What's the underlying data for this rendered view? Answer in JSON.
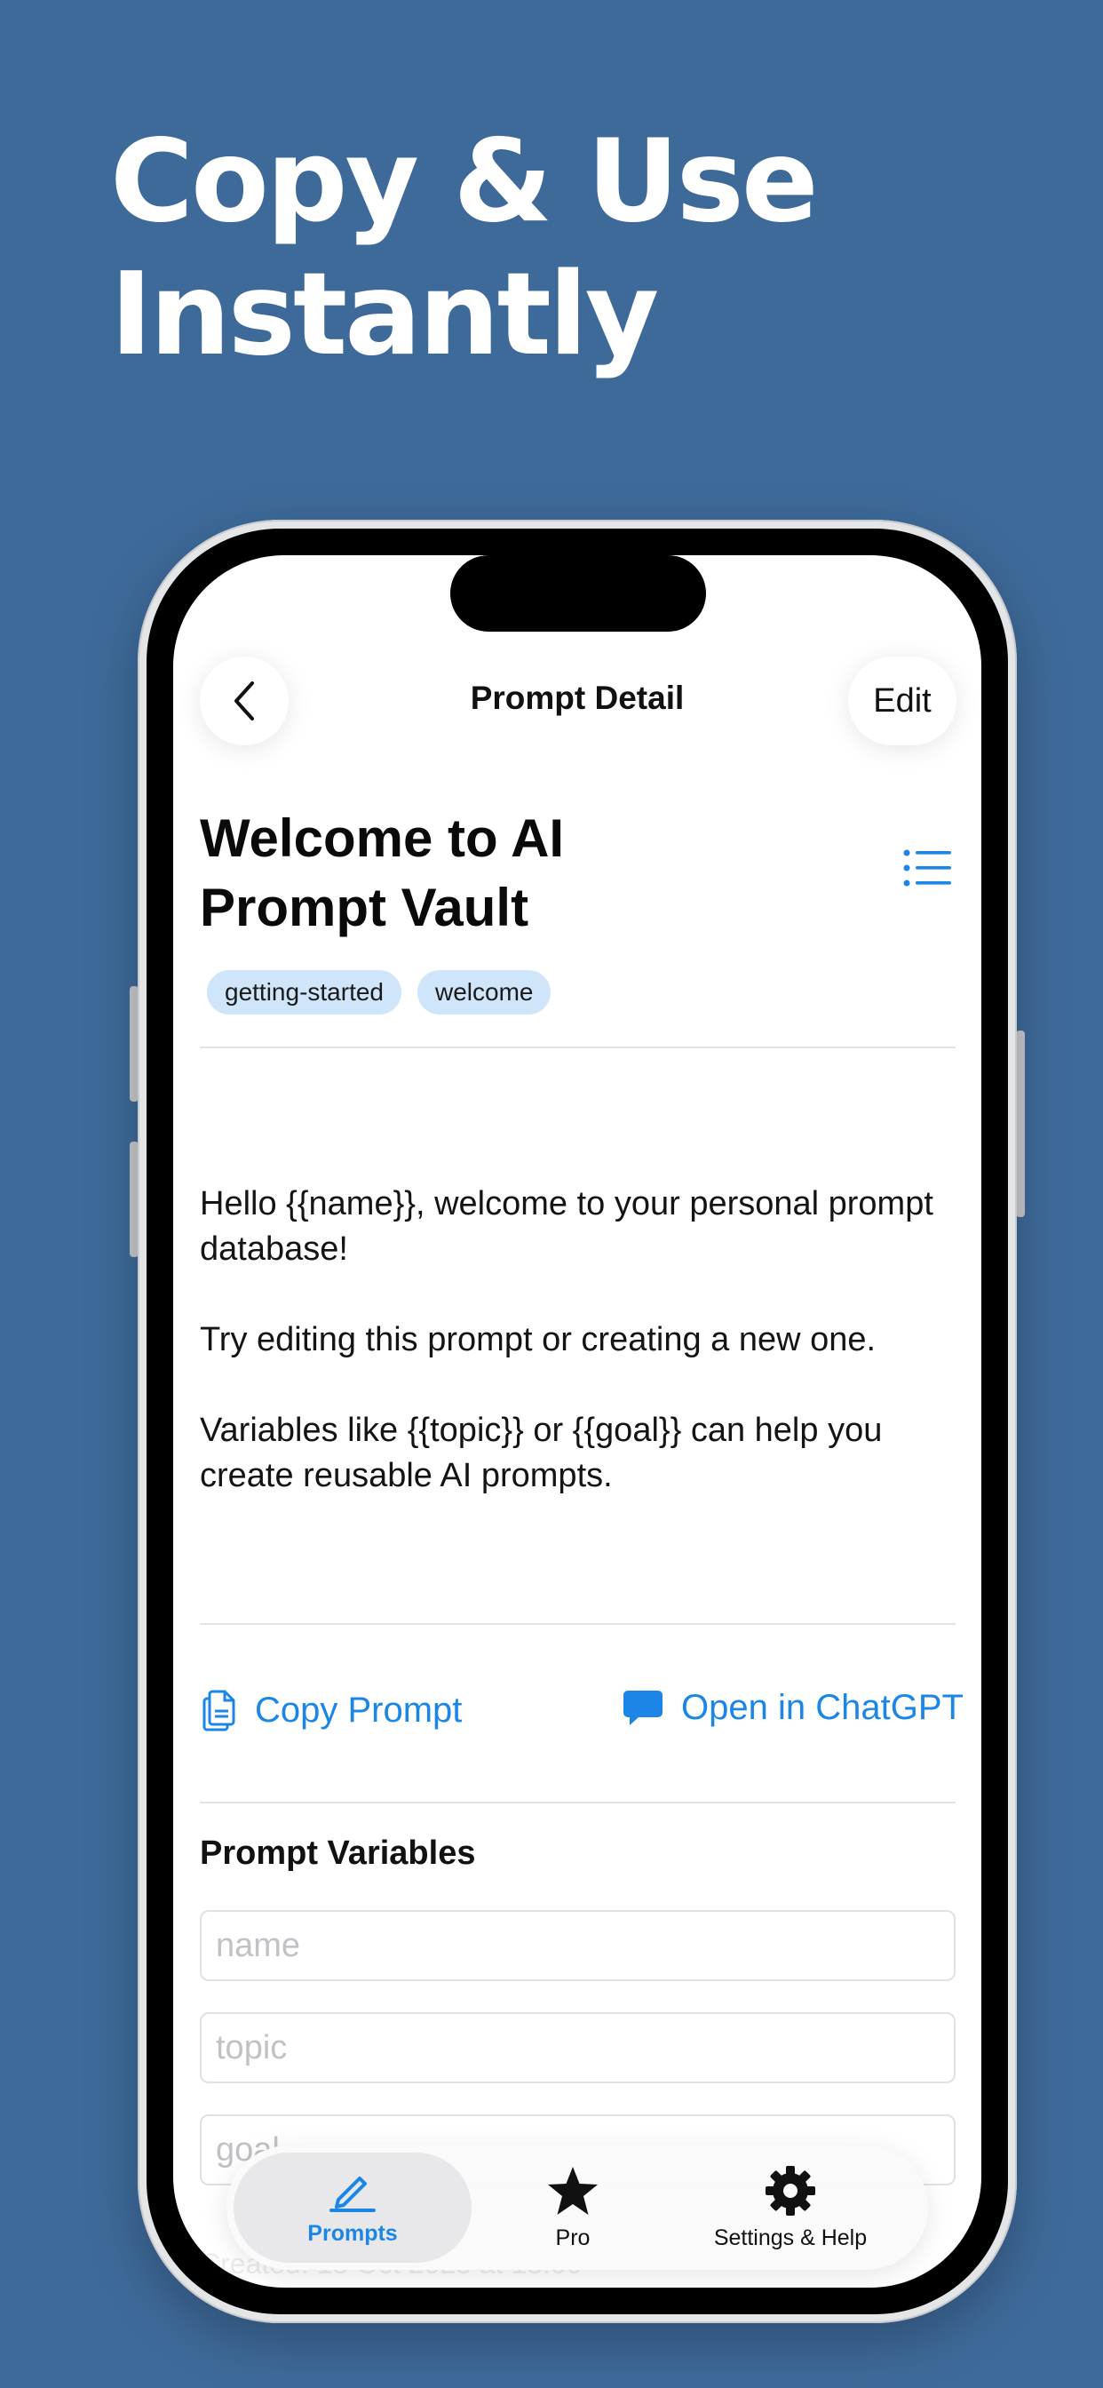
{
  "headline": {
    "line1": "Copy & Use",
    "line2": "Instantly"
  },
  "nav": {
    "back_icon": "chevron-left-icon",
    "title": "Prompt Detail",
    "edit_label": "Edit"
  },
  "prompt": {
    "title": "Welcome to AI Prompt Vault",
    "list_icon": "list-icon",
    "tags": [
      "getting-started",
      "welcome"
    ],
    "body": [
      "Hello {{name}}, welcome to your personal prompt database!",
      "Try editing this prompt or creating a new one.",
      "Variables like {{topic}} or {{goal}} can help you create reusable AI prompts."
    ]
  },
  "actions": {
    "copy_label": "Copy Prompt",
    "copy_icon": "copy-icon",
    "chatgpt_label": "Open in ChatGPT",
    "chatgpt_icon": "chat-bubble-icon"
  },
  "variables": {
    "section_title": "Prompt Variables",
    "fields": [
      {
        "placeholder": "name",
        "value": ""
      },
      {
        "placeholder": "topic",
        "value": ""
      },
      {
        "placeholder": "goal",
        "value": ""
      }
    ]
  },
  "footer": {
    "created_text": "Created: 18 Oct 2025 at 18:00"
  },
  "tabbar": {
    "items": [
      {
        "label": "Prompts",
        "icon": "pencil-icon",
        "active": true
      },
      {
        "label": "Pro",
        "icon": "star-icon",
        "active": false
      },
      {
        "label": "Settings & Help",
        "icon": "gear-icon",
        "active": false
      }
    ]
  },
  "colors": {
    "background": "#3e6a9a",
    "accent": "#1c86e6",
    "tag_bg": "#cfe5fa"
  }
}
